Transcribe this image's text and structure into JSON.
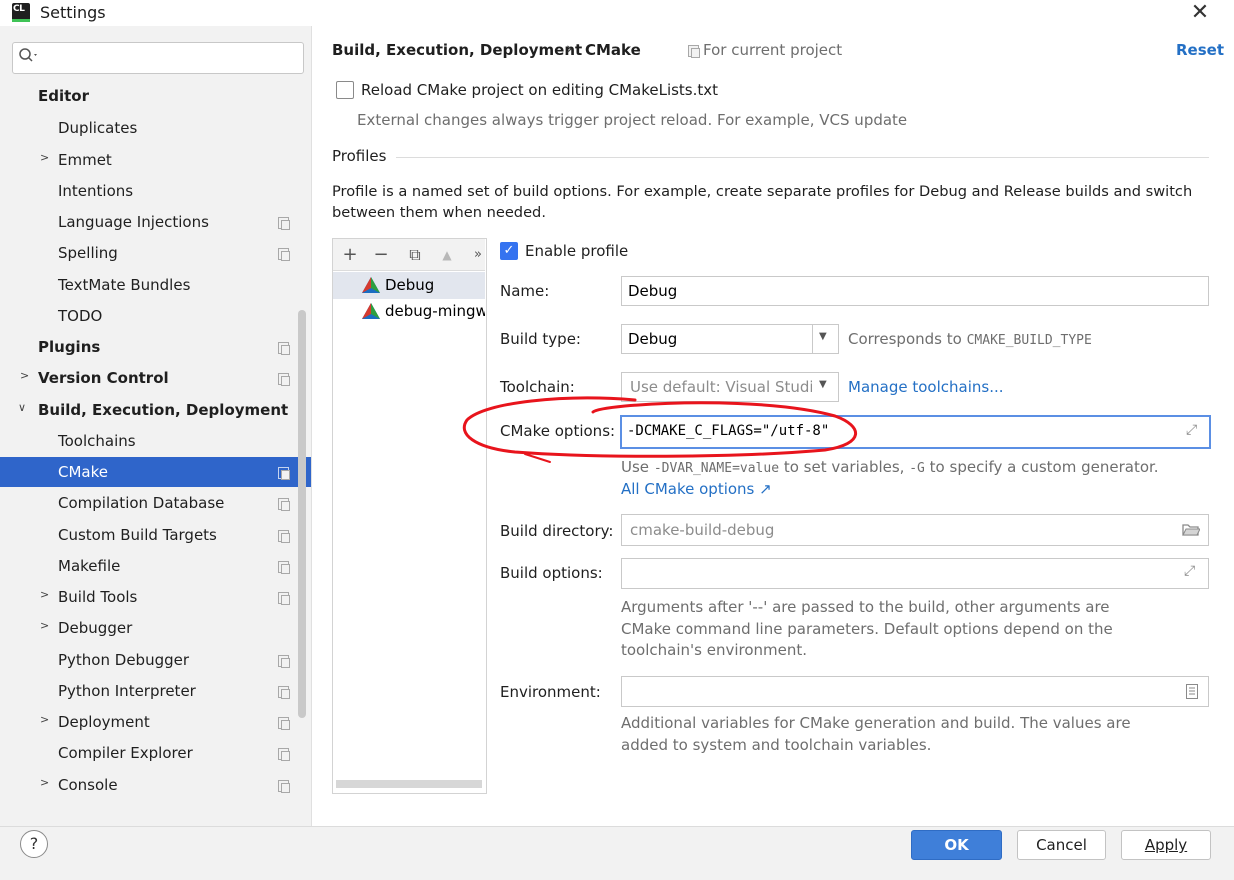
{
  "window": {
    "title": "Settings",
    "app_icon_text": "CL",
    "close_glyph": "✕"
  },
  "search": {
    "placeholder": ""
  },
  "sidebar": {
    "items": [
      {
        "label": "Editor"
      },
      {
        "label": "Duplicates"
      },
      {
        "label": "Emmet"
      },
      {
        "label": "Intentions"
      },
      {
        "label": "Language Injections"
      },
      {
        "label": "Spelling"
      },
      {
        "label": "TextMate Bundles"
      },
      {
        "label": "TODO"
      },
      {
        "label": "Plugins"
      },
      {
        "label": "Version Control"
      },
      {
        "label": "Build, Execution, Deployment"
      },
      {
        "label": "Toolchains"
      },
      {
        "label": "CMake"
      },
      {
        "label": "Compilation Database"
      },
      {
        "label": "Custom Build Targets"
      },
      {
        "label": "Makefile"
      },
      {
        "label": "Build Tools"
      },
      {
        "label": "Debugger"
      },
      {
        "label": "Python Debugger"
      },
      {
        "label": "Python Interpreter"
      },
      {
        "label": "Deployment"
      },
      {
        "label": "Compiler Explorer"
      },
      {
        "label": "Console"
      }
    ],
    "selected": "CMake"
  },
  "header": {
    "breadcrumb_parent": "Build, Execution, Deployment",
    "breadcrumb_sep": "›",
    "breadcrumb_current": "CMake",
    "scope_label": "For current project",
    "reset_label": "Reset"
  },
  "reload": {
    "checkbox_label": "Reload CMake project on editing CMakeLists.txt",
    "checked": false,
    "hint": "External changes always trigger project reload. For example, VCS update"
  },
  "profiles": {
    "section_title": "Profiles",
    "description_line1": "Profile is a named set of build options. For example, create separate profiles for Debug and Release builds and switch",
    "description_line2": "between them when needed.",
    "toolbar": {
      "add": "+",
      "remove": "−",
      "copy": "⧉",
      "up": "▲",
      "more": "»"
    },
    "list": [
      {
        "name": "Debug",
        "selected": true
      },
      {
        "name": "debug-mingw",
        "selected": false
      }
    ]
  },
  "form": {
    "enable_profile_label": "Enable profile",
    "enable_profile_checked": true,
    "name_label": "Name:",
    "name_value": "Debug",
    "build_type_label": "Build type:",
    "build_type_value": "Debug",
    "build_type_hint_prefix": "Corresponds to",
    "build_type_hint_code": "CMAKE_BUILD_TYPE",
    "toolchain_label": "Toolchain:",
    "toolchain_value": "Use default: Visual Studio",
    "manage_toolchains": "Manage toolchains...",
    "cmake_options_label": "CMake options:",
    "cmake_options_value": "-DCMAKE_C_FLAGS=\"/utf-8\"",
    "cmake_hint_use": "Use",
    "cmake_hint_code1": "-DVAR_NAME=value",
    "cmake_hint_mid": "to set variables,",
    "cmake_hint_code2": "-G",
    "cmake_hint_end": "to specify a custom generator.",
    "all_cmake_options": "All CMake options ↗",
    "build_dir_label": "Build directory:",
    "build_dir_value": "cmake-build-debug",
    "build_options_label": "Build options:",
    "build_options_value": "",
    "build_options_hint1": "Arguments after '--' are passed to the build, other arguments are",
    "build_options_hint2": "CMake command line parameters. Default options depend on the",
    "build_options_hint3": "toolchain's environment.",
    "environment_label": "Environment:",
    "environment_value": "",
    "environment_hint1": "Additional variables for CMake generation and build. The values are",
    "environment_hint2": "added to system and toolchain variables."
  },
  "footer": {
    "help": "?",
    "ok": "OK",
    "cancel": "Cancel",
    "apply": "Apply"
  },
  "colors": {
    "accent": "#2f65ca",
    "link": "#2470c5",
    "annotation": "#e8141c",
    "ok_button": "#3f7fd9"
  }
}
